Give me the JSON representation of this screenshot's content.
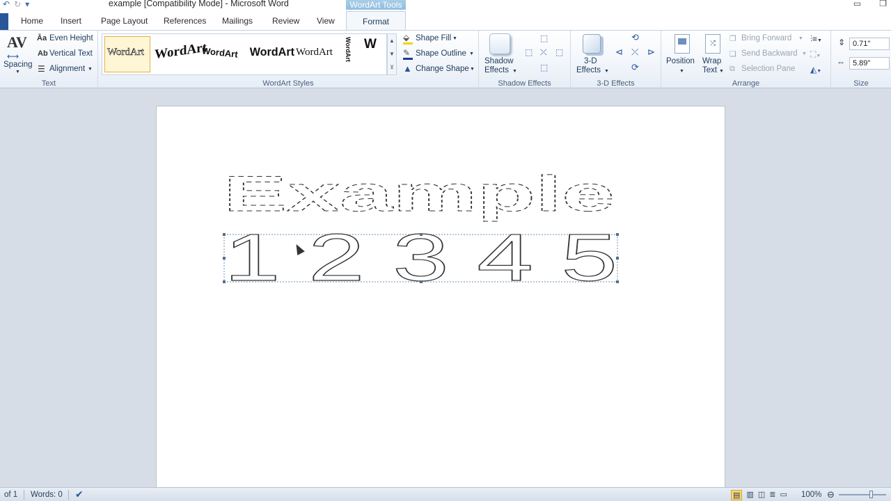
{
  "window": {
    "title": "example [Compatibility Mode]  -  Microsoft Word",
    "contextual_header": "WordArt Tools",
    "controls": {
      "minimize": "▭",
      "restore": "❐"
    }
  },
  "qat": {
    "undo": "↶",
    "redo": "↻",
    "customize": "▾"
  },
  "tabs": {
    "home": "Home",
    "insert": "Insert",
    "page_layout": "Page Layout",
    "references": "References",
    "mailings": "Mailings",
    "review": "Review",
    "view": "View",
    "format": "Format"
  },
  "ribbon": {
    "text_group": {
      "label": "Text",
      "spacing": "Spacing",
      "spacing_icon": "AV",
      "even_height": "Even Height",
      "vertical_text": "Vertical Text",
      "alignment": "Alignment"
    },
    "wordart_styles": {
      "label": "WordArt Styles",
      "samples": [
        "WordArt",
        "WordArt",
        "WordArt",
        "WordArt",
        "WordArt",
        "WordArt",
        "W"
      ],
      "shape_fill": "Shape Fill",
      "shape_outline": "Shape Outline",
      "change_shape": "Change Shape"
    },
    "shadow_group": {
      "label": "Shadow Effects",
      "shadow_effects_1": "Shadow",
      "shadow_effects_2": "Effects"
    },
    "threed_group": {
      "label": "3-D Effects",
      "threed_effects_1": "3-D",
      "threed_effects_2": "Effects"
    },
    "arrange_group": {
      "label": "Arrange",
      "position": "Position",
      "wrap_text_1": "Wrap",
      "wrap_text_2": "Text",
      "bring_forward": "Bring Forward",
      "send_backward": "Send Backward",
      "selection_pane": "Selection Pane"
    },
    "size_group": {
      "label": "Size",
      "height": "0.71\"",
      "width": "5.89\""
    }
  },
  "document": {
    "line1": "Example",
    "line2": "1 2 3 4 5"
  },
  "statusbar": {
    "page": "of 1",
    "words": "Words: 0",
    "zoom": "100%"
  },
  "colors": {
    "accent": "#2a5699",
    "ribbon_text": "#1e395b",
    "context_tab": "#9cc4e4"
  }
}
